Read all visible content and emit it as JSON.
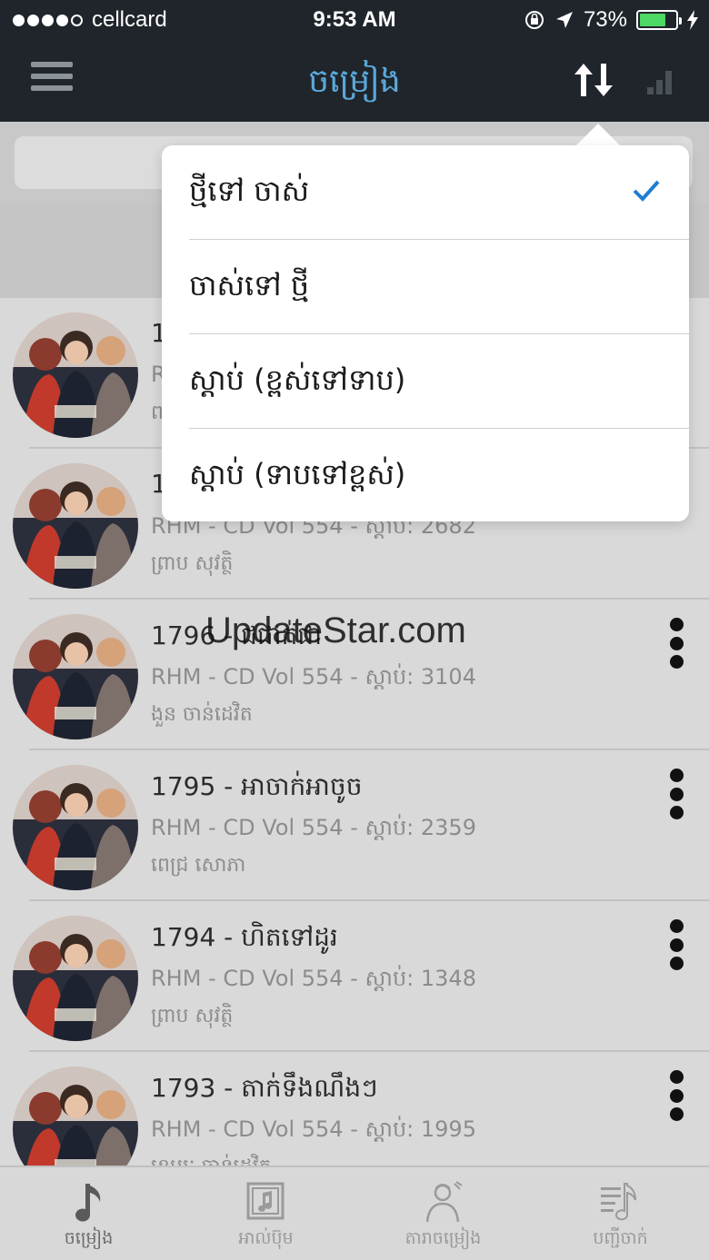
{
  "status_bar": {
    "carrier": "cellcard",
    "time": "9:53 AM",
    "battery_percent": "73%",
    "battery_level": 0.73,
    "signal_bars": 4,
    "signal_total": 5
  },
  "nav": {
    "title": "ចម្រៀង",
    "title_color": "#5ba8d8",
    "left_icon": "menu-icon",
    "right_icons": [
      "sort-icon",
      "signal-bars-icon"
    ]
  },
  "sort_menu": {
    "selected_index": 0,
    "accent_color": "#1f7dd1",
    "items": [
      {
        "label": "ថ្មីទៅ ចាស់"
      },
      {
        "label": "ចាស់ទៅ ថ្មី"
      },
      {
        "label": "ស្តាប់ (ខ្ពស់ទៅទាប)"
      },
      {
        "label": "ស្តាប់ (ទាបទៅខ្ពស់)"
      }
    ]
  },
  "songs": [
    {
      "title": "1",
      "subtitle": "R",
      "artist": "ព"
    },
    {
      "title": "1",
      "subtitle": "RHM - CD Vol 554 - ស្តាប់: 2682",
      "artist": "ព្រាប សុវត្ថិ"
    },
    {
      "title": "1796 - ជជាក់ជា",
      "subtitle": "RHM - CD Vol 554 - ស្តាប់: 3104",
      "artist": "ងួន ចាន់ដេវិត"
    },
    {
      "title": "1795 - អាចាក់អាចូច",
      "subtitle": "RHM - CD Vol 554 - ស្តាប់: 2359",
      "artist": "ពេជ្រ សោភា"
    },
    {
      "title": "1794 - ហិតទៅដូរ",
      "subtitle": "RHM - CD Vol 554 - ស្តាប់: 1348",
      "artist": "ព្រាប សុវត្ថិ"
    },
    {
      "title": "1793 - តាក់ទឹងណឹងៗ",
      "subtitle": "RHM - CD Vol 554 - ស្តាប់: 1995",
      "artist": "ខេមរៈ ចាន់ដេវិត"
    }
  ],
  "watermark": "UpdateStar.com",
  "tabs": [
    {
      "label": "ចម្រៀង",
      "icon": "music-note-icon"
    },
    {
      "label": "អាល់ប៊ុម",
      "icon": "album-icon"
    },
    {
      "label": "តារាចម្រៀង",
      "icon": "singer-icon"
    },
    {
      "label": "បញ្ជីចាក់",
      "icon": "playlist-icon"
    }
  ]
}
